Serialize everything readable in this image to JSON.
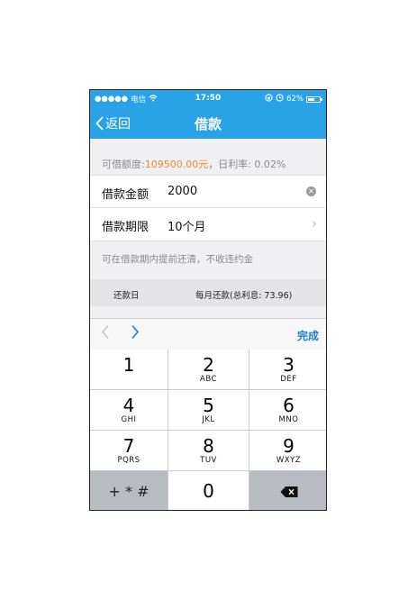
{
  "status": {
    "carrier": "电信",
    "time": "17:50",
    "battery": "62%",
    "battery_level": 0.62
  },
  "nav": {
    "back_label": "返回",
    "title": "借款"
  },
  "info": {
    "prefix": "可借额度:",
    "amount": "109500.00元",
    "rate_text": "，日利率: 0.02%"
  },
  "form": {
    "amount_label": "借款金额",
    "amount_value": "2000",
    "term_label": "借款期限",
    "term_value": "10个月"
  },
  "note": "可在借款期内提前还清，不收违约金",
  "schedule": {
    "col1": "还款日",
    "col2": "每月还款(总利息: 73.96)"
  },
  "toolbar": {
    "done": "完成"
  },
  "keys": [
    {
      "num": "1",
      "letters": ""
    },
    {
      "num": "2",
      "letters": "ABC"
    },
    {
      "num": "3",
      "letters": "DEF"
    },
    {
      "num": "4",
      "letters": "GHI"
    },
    {
      "num": "5",
      "letters": "JKL"
    },
    {
      "num": "6",
      "letters": "MNO"
    },
    {
      "num": "7",
      "letters": "PQRS"
    },
    {
      "num": "8",
      "letters": "TUV"
    },
    {
      "num": "9",
      "letters": "WXYZ"
    },
    {
      "num": "0",
      "letters": ""
    }
  ],
  "symbol_key": "+ * #",
  "colors": {
    "primary": "#2aa2e8",
    "amount": "#f08b2e",
    "link": "#1b7fd6"
  }
}
